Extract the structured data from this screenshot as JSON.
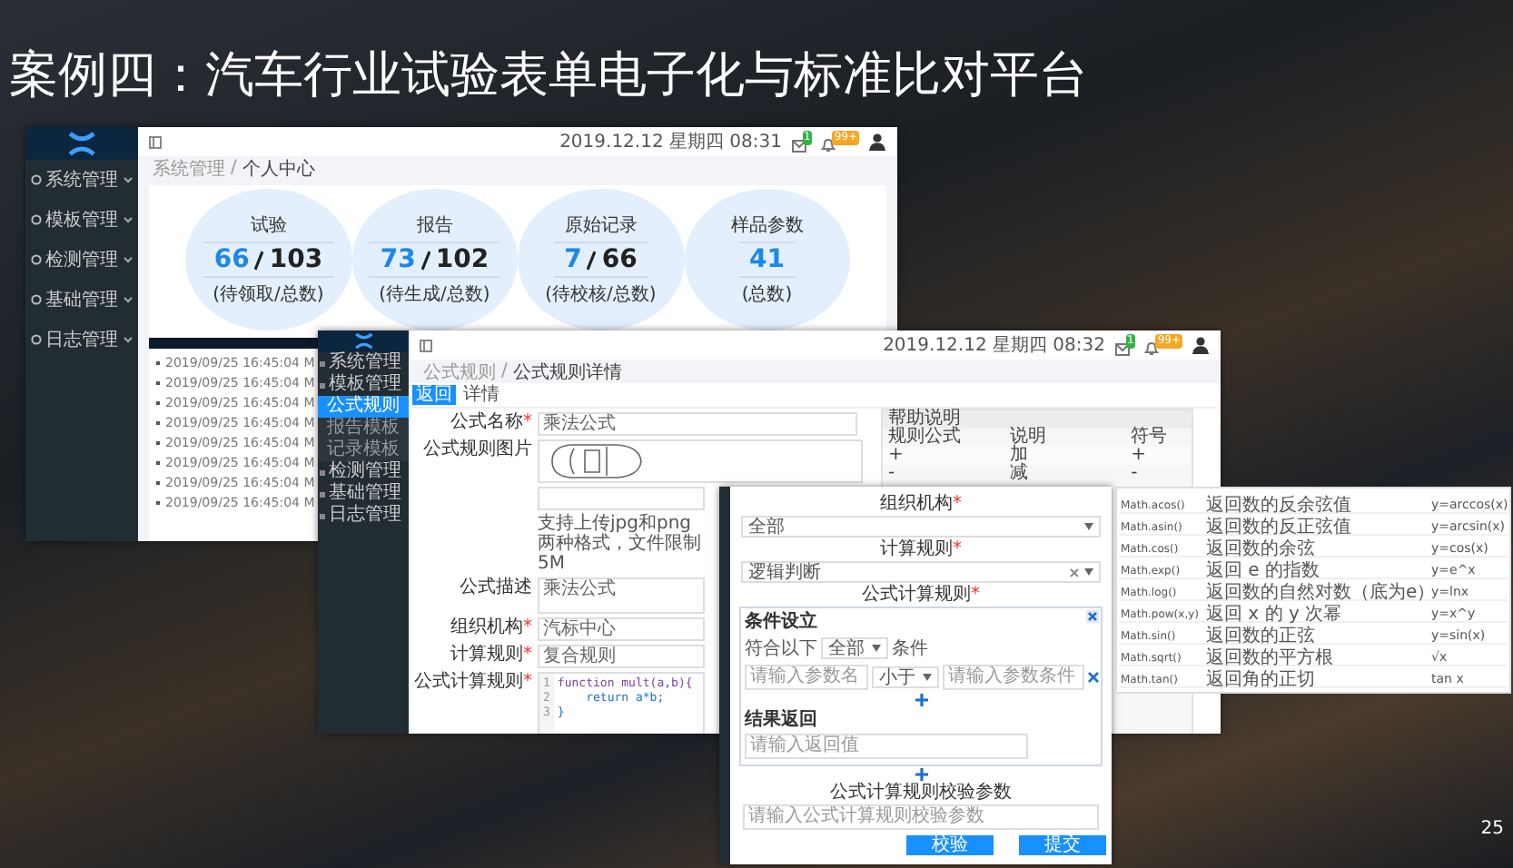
{
  "slide": {
    "title": "案例四：汽车行业试验表单电子化与标准比对平台",
    "page_number": "25"
  },
  "dashboard_window": {
    "datetime": "2019.12.12 星期四 08:31",
    "mail_badge": "1",
    "notice_badge": "99+",
    "menu": [
      {
        "label": "系统管理"
      },
      {
        "label": "模板管理"
      },
      {
        "label": "检测管理"
      },
      {
        "label": "基础管理"
      },
      {
        "label": "日志管理"
      }
    ],
    "breadcrumb": {
      "items": [
        "系统管理",
        "个人中心"
      ],
      "separator": "/"
    },
    "stats": [
      {
        "title": "试验",
        "pending": "66",
        "total": "103",
        "caption": "(待领取/总数)"
      },
      {
        "title": "报告",
        "pending": "73",
        "total": "102",
        "caption": "(待生成/总数)"
      },
      {
        "title": "原始记录",
        "pending": "7",
        "total": "66",
        "caption": "(待校核/总数)"
      },
      {
        "title": "样品参数",
        "total": "41",
        "caption": "(总数)"
      }
    ],
    "log_rows": [
      "2019/09/25 16:45:04 M",
      "2019/09/25 16:45:04 M",
      "2019/09/25 16:45:04 M",
      "2019/09/25 16:45:04 M",
      "2019/09/25 16:45:04 M",
      "2019/09/25 16:45:04 M",
      "2019/09/25 16:45:04 M",
      "2019/09/25 16:45:04 M"
    ]
  },
  "formula_window": {
    "datetime": "2019.12.12 星期四 08:32",
    "mail_badge": "1",
    "notice_badge": "99+",
    "menu": [
      {
        "label": "系统管理",
        "selected": false
      },
      {
        "label": "模板管理",
        "expanded": true,
        "selected": false,
        "children": [
          {
            "label": "公式规则",
            "selected": true
          },
          {
            "label": "报告模板",
            "selected": false
          },
          {
            "label": "记录模板",
            "selected": false
          }
        ]
      },
      {
        "label": "检测管理",
        "selected": false
      },
      {
        "label": "基础管理",
        "selected": false
      },
      {
        "label": "日志管理",
        "selected": false
      }
    ],
    "breadcrumb": {
      "items": [
        "公式规则",
        "公式规则详情"
      ],
      "separator": "/"
    },
    "tabs": [
      {
        "label": "返回",
        "selected": true
      },
      {
        "label": "详情",
        "selected": false
      }
    ],
    "fields": [
      {
        "kind": "text",
        "label": "公式名称",
        "mark": "*",
        "value": "乘法公式"
      },
      {
        "kind": "image",
        "label": "公式规则图片",
        "hint": "支持上传jpg和png两种格式，文件限制5M"
      },
      {
        "kind": "textarea",
        "label": "公式描述",
        "value": "乘法公式"
      },
      {
        "kind": "select",
        "label": "组织机构",
        "mark": "*",
        "value": "汽标中心"
      },
      {
        "kind": "select",
        "label": "计算规则",
        "mark": "*",
        "value": "复合规则"
      },
      {
        "kind": "code",
        "label": "公式计算规则",
        "mark": "*",
        "line_numbers": [
          "1",
          "2",
          "3"
        ],
        "lines": [
          "function mult(a,b){",
          "    return a*b;",
          "}"
        ]
      }
    ],
    "help_table": {
      "title": "帮助说明",
      "columns": [
        "规则公式",
        "说明",
        "符号"
      ],
      "rows": [
        [
          "+",
          "加",
          "+"
        ],
        [
          "-",
          "减",
          "-"
        ]
      ]
    }
  },
  "rule_window": {
    "organization": {
      "label": "组织机构",
      "mark": "*",
      "value": "全部"
    },
    "calc_rule": {
      "label": "计算规则",
      "mark": "*",
      "value": "逻辑判断"
    },
    "rule": {
      "label": "公式计算规则",
      "mark": "*",
      "title": "条件设立",
      "match_prefix": "符合以下",
      "match_value": "全部",
      "match_suffix": "条件",
      "param_placeholder": "请输入参数名",
      "operator": "小于",
      "condition_placeholder": "请输入参数条件",
      "result_title": "结果返回",
      "result_placeholder": "请输入返回值"
    },
    "check": {
      "label": "公式计算规则校验参数",
      "placeholder": "请输入公式计算规则校验参数"
    },
    "buttons": [
      "校验",
      "提交"
    ]
  },
  "math_table": {
    "rows": [
      [
        "Math.acos()",
        "返回数的反余弦值",
        "y=arccos(x)"
      ],
      [
        "Math.asin()",
        "返回数的反正弦值",
        "y=arcsin(x)"
      ],
      [
        "Math.cos()",
        "返回数的余弦",
        "y=cos(x)"
      ],
      [
        "Math.exp()",
        "返回 e 的指数",
        "y=e^x"
      ],
      [
        "Math.log()",
        "返回数的自然对数（底为e）",
        "y=lnx"
      ],
      [
        "Math.pow(x,y)",
        "返回 x 的 y 次幂",
        "y=x^y"
      ],
      [
        "Math.sin()",
        "返回数的正弦",
        "y=sin(x)"
      ],
      [
        "Math.sqrt()",
        "返回数的平方根",
        "√x"
      ],
      [
        "Math.tan()",
        "返回角的正切",
        "tan x"
      ]
    ]
  }
}
